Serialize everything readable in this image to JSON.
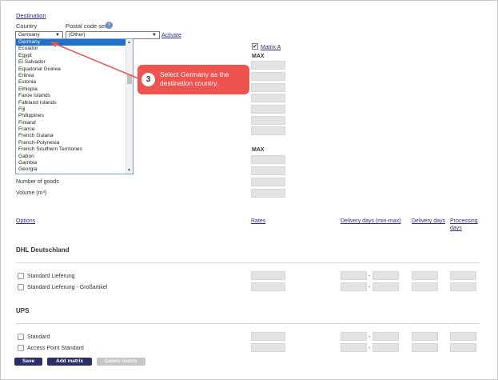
{
  "destination": {
    "heading": "Destination",
    "country_label": "Country",
    "postal_label": "Postal code sets",
    "country_value": "Germany",
    "postal_value": "(Other)",
    "activate_link": "Activate"
  },
  "country_dropdown": {
    "items": [
      "Germany",
      "Ecuador",
      "Egypt",
      "El Salvador",
      "Equatorial Guinea",
      "Eritrea",
      "Estonia",
      "Ethiopia",
      "Faroe Islands",
      "Falkland Islands",
      "Fiji",
      "Philippines",
      "Finland",
      "France",
      "French Guiana",
      "French-Polynesia",
      "French Southern Territories",
      "Gabon",
      "Gambia",
      "Georgia"
    ],
    "selected": "Germany"
  },
  "callout": {
    "number": "3",
    "text": "Select Germany as the destination country."
  },
  "matrix": {
    "matrix_a_label": "Matrix A",
    "max_label_1": "MAX",
    "max_label_2": "MAX",
    "number_of_goods": "Number of goods",
    "volume": "Volume (m³)"
  },
  "options_table": {
    "headers": {
      "options": "Options",
      "rates": "Rates",
      "delivery_min_max": "Delivery days (min-max)",
      "delivery_days": "Delivery days",
      "processing_days": "Processing days"
    },
    "carriers": [
      {
        "name": "DHL Deutschland",
        "options": [
          "Standard Lieferung",
          "Standard Lieferung - Großartikel"
        ]
      },
      {
        "name": "UPS",
        "options": [
          "Standard",
          "Access Point Standard"
        ]
      }
    ],
    "range_sep": "-"
  },
  "buttons": {
    "save": "Save",
    "add_matrix": "Add matrix",
    "delete_matrix": "Delete matrix"
  },
  "colors": {
    "accent": "#ef5350",
    "button_dark": "#2b2d6b",
    "selection": "#1e70c8",
    "field_bg": "#e3e3e3"
  }
}
